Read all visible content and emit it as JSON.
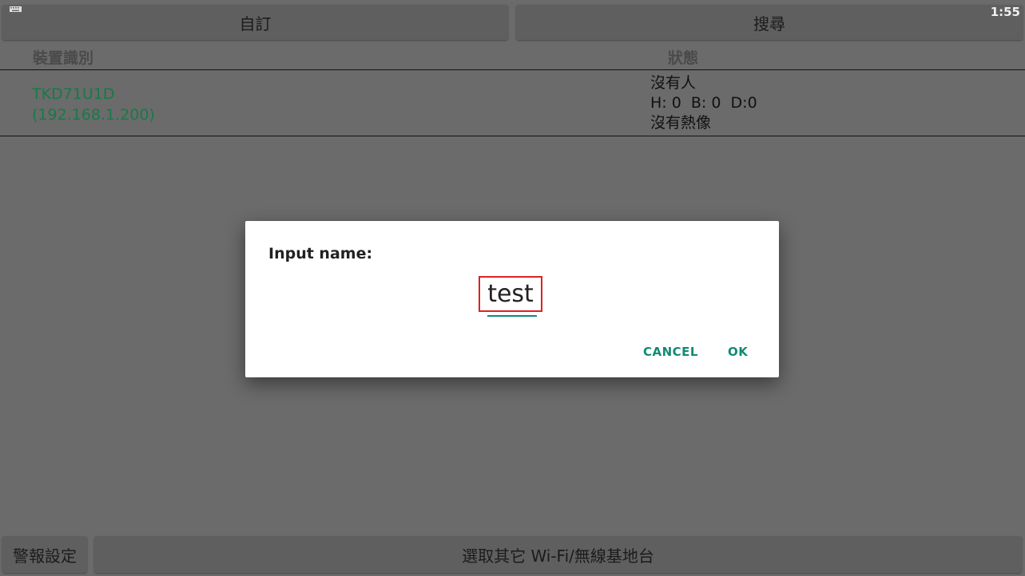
{
  "status_bar": {
    "clock": "1:55",
    "keyboard_icon": "keyboard-icon"
  },
  "top_buttons": {
    "custom_label": "自訂",
    "search_label": "搜尋"
  },
  "table": {
    "headers": {
      "device_id": "裝置識別",
      "status": "狀態"
    },
    "rows": [
      {
        "device_name": "TKD71U1D",
        "ip": "(192.168.1.200)",
        "status_line1": "沒有人",
        "status_line2": "H: 0  B: 0  D:0",
        "status_line3": "沒有熱像"
      }
    ]
  },
  "dialog": {
    "title": "Input name:",
    "input_value": "test",
    "cancel_label": "CANCEL",
    "ok_label": "OK"
  },
  "bottom_buttons": {
    "alarm_label": "警報設定",
    "wifi_label": "選取其它 Wi-Fi/無線基地台"
  },
  "colors": {
    "accent": "#128a72",
    "device_text": "#177a48",
    "highlight": "#dd2222"
  }
}
